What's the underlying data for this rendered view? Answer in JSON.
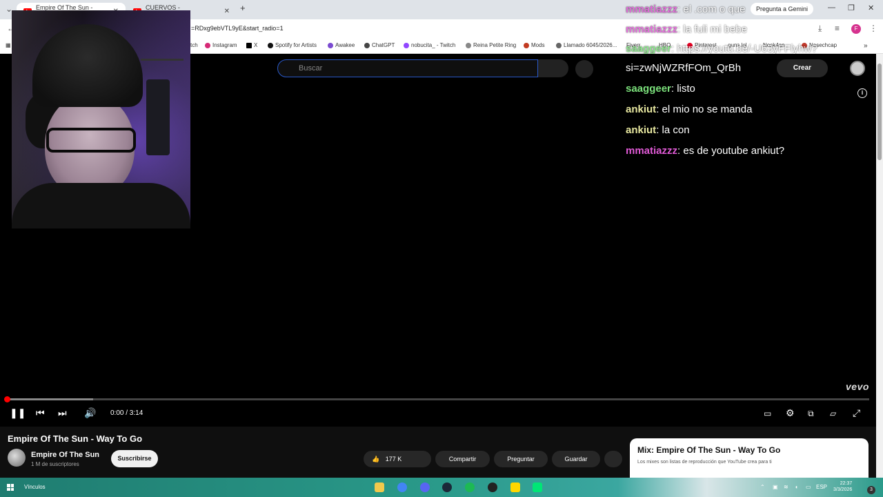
{
  "browser": {
    "tabs": [
      {
        "title": "Empire Of The Sun - Way To G",
        "active": true
      },
      {
        "title": "CUERVOS - YouTube",
        "active": false
      }
    ],
    "new_tab": "+",
    "url": "=RDxg9ebVTL9yE&start_radio=1",
    "gemini": "Pregunta a Gemini",
    "bookmarks": [
      {
        "label": "tch",
        "x": "left"
      },
      {
        "label": "Instagram"
      },
      {
        "label": "X"
      },
      {
        "label": "Spotify for Artists"
      },
      {
        "label": "Awakee"
      },
      {
        "label": "ChatGPT"
      },
      {
        "label": "nobucita_ - Twitch"
      },
      {
        "label": "Reina Petite Ring"
      },
      {
        "label": "Mods"
      },
      {
        "label": "Llamado 6045/2026..."
      },
      {
        "label": "Fiverr"
      },
      {
        "label": "HBO"
      },
      {
        "label": "Pinterest"
      },
      {
        "label": "guns.lol"
      },
      {
        "label": "Nosk4an"
      },
      {
        "label": "Nasechcap"
      }
    ]
  },
  "youtube": {
    "search_placeholder": "Buscar",
    "create_label": "Crear",
    "video_title": "Empire Of The Sun - Way To Go",
    "channel_name": "Empire Of The Sun",
    "channel_subs": "1 M de suscriptores",
    "subscribe_label": "Suscribirse",
    "likes": "177 K",
    "share_label": "Compartir",
    "ask_label": "Preguntar",
    "save_label": "Guardar",
    "time_display": "0:00 / 3:14",
    "progress_fraction": 0.0,
    "buffered_fraction": 0.1,
    "vevo": "vevo",
    "mix_title": "Mix: Empire Of The Sun - Way To Go",
    "mix_desc": "Los mixes son listas de reproducción que YouTube crea para ti"
  },
  "chat": [
    {
      "user": "mmatiazzz",
      "color": "#e05ad6",
      "message": "el .com o que"
    },
    {
      "user": "mmatiazzz",
      "color": "#e05ad6",
      "message": "la fuli mi bebe"
    },
    {
      "user": "saaggeer",
      "color": "#7be07b",
      "message": "https://youtu.be/-U63yFFlyhw?"
    },
    {
      "user": "",
      "color": "#ffffff",
      "message": "si=zwNjWZRfFOm_QrBh"
    },
    {
      "user": "saaggeer",
      "color": "#7be07b",
      "message": "listo"
    },
    {
      "user": "ankiut",
      "color": "#e8e8a0",
      "message": "el mio no se manda"
    },
    {
      "user": "ankiut",
      "color": "#e8e8a0",
      "message": "la con"
    },
    {
      "user": "mmatiazzz",
      "color": "#e05ad6",
      "message": "es de youtube ankiut?"
    }
  ],
  "taskbar": {
    "links_label": "Vínculos",
    "lang": "ESP",
    "time": "22:37",
    "date": "3/3/2026",
    "notifications": "3"
  }
}
